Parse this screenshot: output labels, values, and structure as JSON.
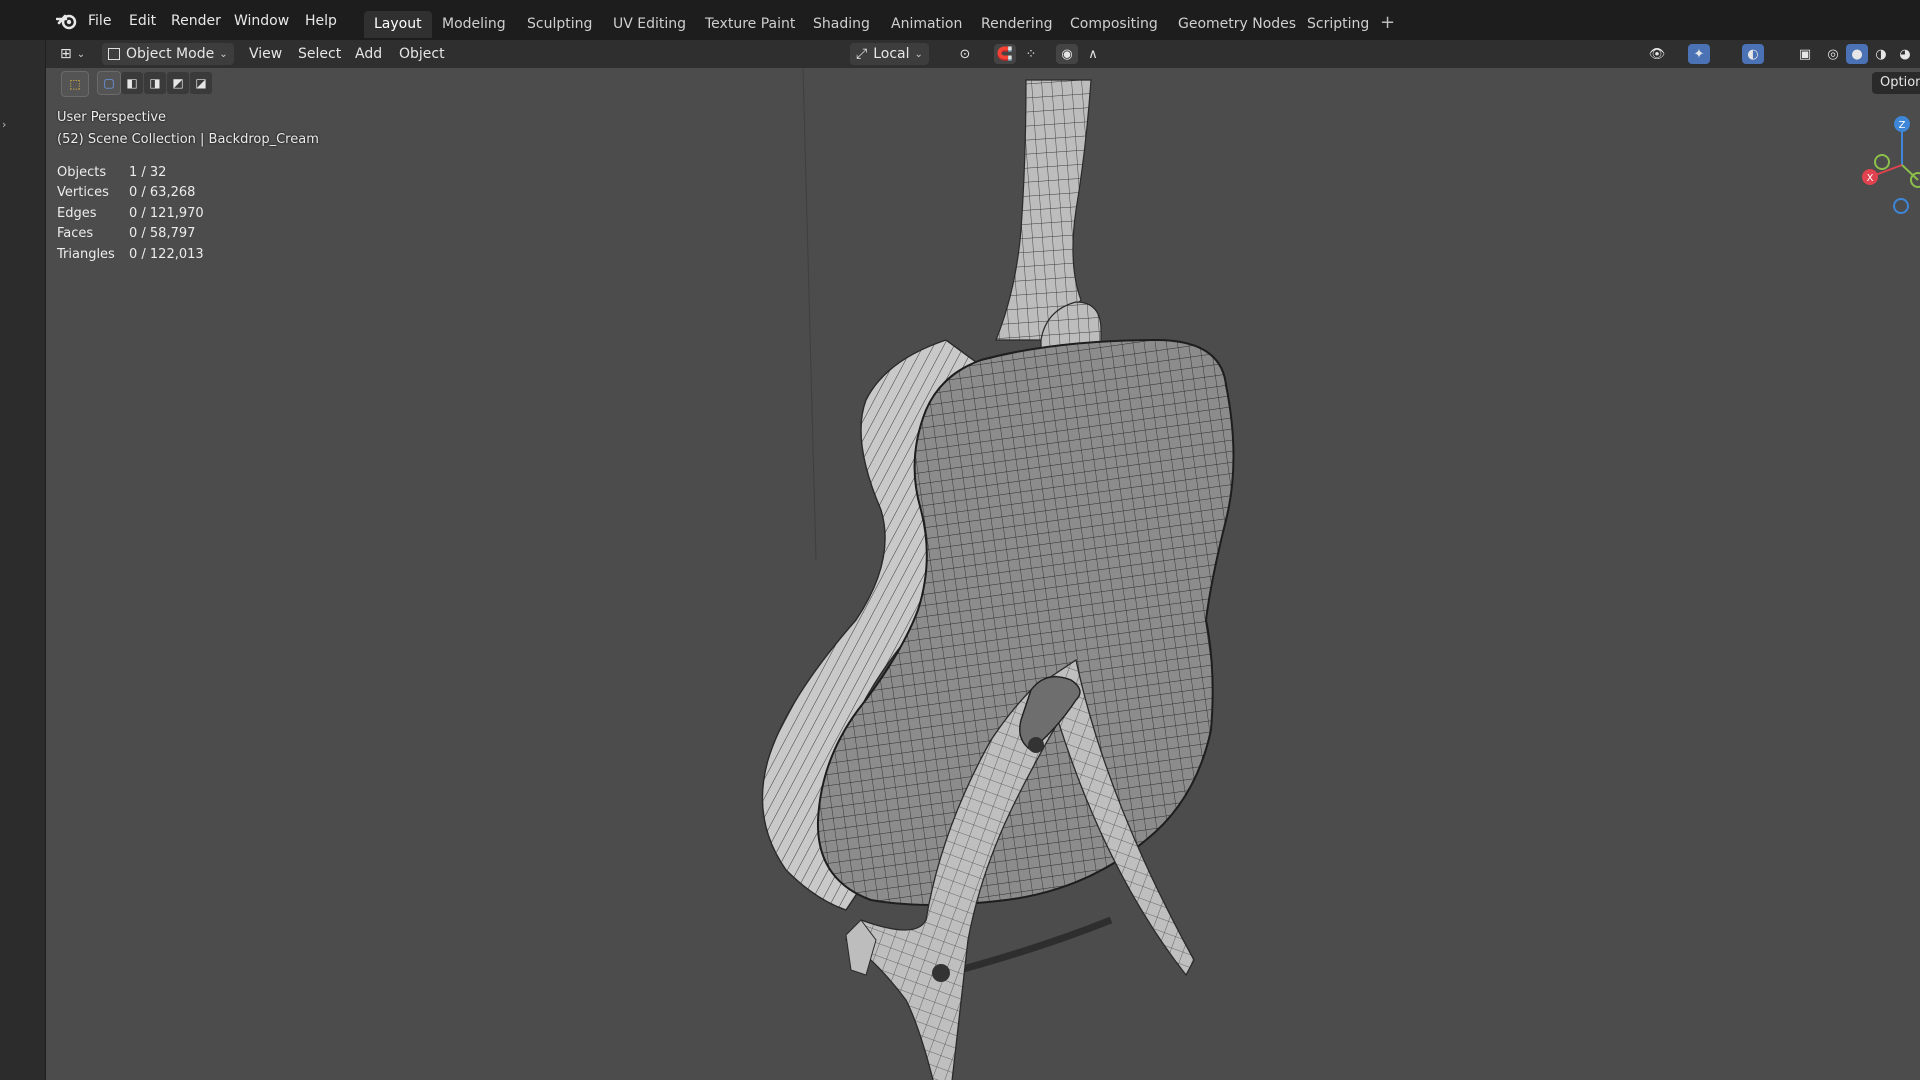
{
  "topbar": {
    "menus": [
      "File",
      "Edit",
      "Render",
      "Window",
      "Help"
    ],
    "workspaces": [
      "Layout",
      "Modeling",
      "Sculpting",
      "UV Editing",
      "Texture Paint",
      "Shading",
      "Animation",
      "Rendering",
      "Compositing",
      "Geometry Nodes",
      "Scripting"
    ],
    "active_workspace": "Layout",
    "add_workspace": "+"
  },
  "header": {
    "mode": "Object Mode",
    "menus": [
      "View",
      "Select",
      "Add",
      "Object"
    ],
    "transform_orientation": "Local",
    "options_label": "Options"
  },
  "overlay": {
    "view_name": "User Perspective",
    "collection": "(52) Scene Collection | Backdrop_Cream",
    "stats": [
      {
        "label": "Objects",
        "value": "1 / 32"
      },
      {
        "label": "Vertices",
        "value": "0 / 63,268"
      },
      {
        "label": "Edges",
        "value": "0 / 121,970"
      },
      {
        "label": "Faces",
        "value": "0 / 58,797"
      },
      {
        "label": "Triangles",
        "value": "0 / 122,013"
      }
    ]
  },
  "gizmo": {
    "z": "Z",
    "x": "X"
  },
  "colors": {
    "accent": "#4a72b5",
    "viewport_bg": "#4c4c4c",
    "axis_x": "#e0424f",
    "axis_y": "#8cc04a",
    "axis_z": "#3d86d8"
  }
}
